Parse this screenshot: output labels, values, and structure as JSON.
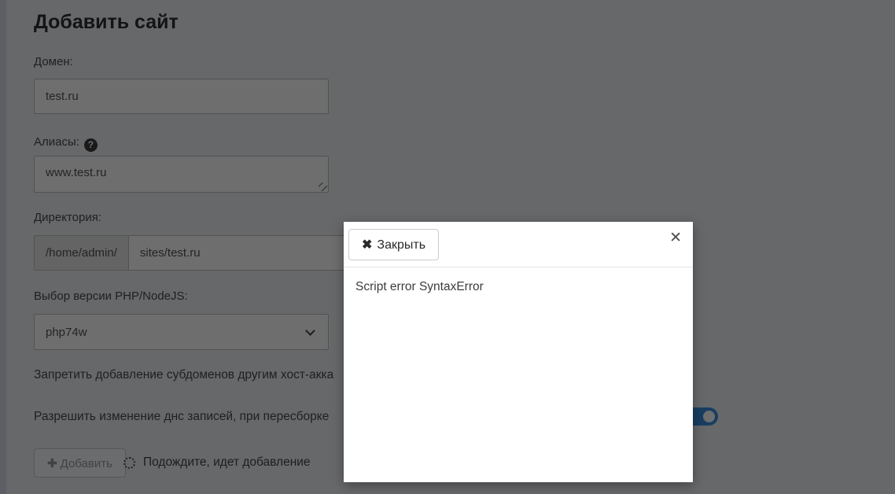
{
  "page": {
    "title": "Добавить сайт"
  },
  "form": {
    "domain": {
      "label": "Домен:",
      "value": "test.ru"
    },
    "aliases": {
      "label": "Алиасы:",
      "value": "www.test.ru",
      "help_icon_glyph": "?"
    },
    "directory": {
      "label": "Директория:",
      "prefix": "/home/admin/",
      "value": "sites/test.ru"
    },
    "php_version": {
      "label": "Выбор версии PHP/NodeJS:",
      "selected": "php74w"
    },
    "toggles": [
      {
        "label": "Запретить добавление субдоменов другим хост-акка",
        "state_visible": "hidden-behind-modal"
      },
      {
        "label": "Разрешить изменение днс записей, при пересборке",
        "state_visible": "on"
      }
    ],
    "submit": {
      "label": "Добавить",
      "plus_glyph": "✚",
      "disabled": true
    },
    "progress": {
      "text": "Подождите, идет добавление"
    }
  },
  "modal": {
    "close_button_label": "Закрыть",
    "close_button_glyph": "✖",
    "corner_close_glyph": "✕",
    "body_text": "Script error SyntaxError"
  },
  "colors": {
    "page_background": "#ecf0f5",
    "backdrop": "rgba(0,0,0,0.57)",
    "toggle_on": "#3a8fe0",
    "modal_background": "#ffffff"
  }
}
